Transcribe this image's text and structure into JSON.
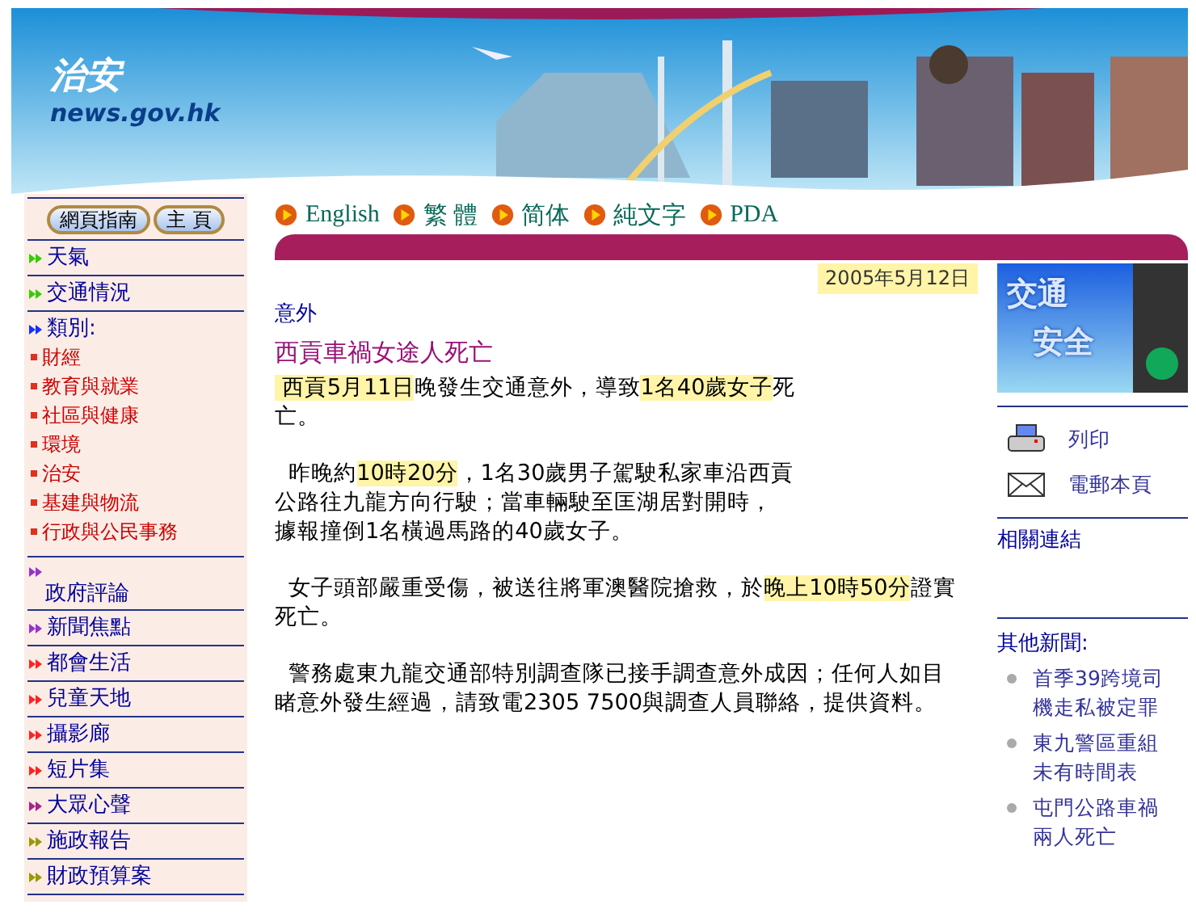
{
  "header": {
    "title": "治安",
    "site": "news.gov.hk"
  },
  "top_buttons": [
    "網頁指南",
    "主 頁"
  ],
  "sidebar": [
    {
      "label": "天氣",
      "color": "#33cc00",
      "kind": "link"
    },
    {
      "label": "交通情況",
      "color": "#33cc00",
      "kind": "link"
    },
    {
      "label": "類別:",
      "color": "#1133ff",
      "kind": "group",
      "children": [
        "財經",
        "教育與就業",
        "社區與健康",
        "環境",
        "治安",
        "基建與物流",
        "行政與公民事務"
      ]
    },
    {
      "label": "政府評論",
      "color": "#9933cc",
      "kind": "stacked"
    },
    {
      "label": "新聞焦點",
      "color": "#9933cc",
      "kind": "link"
    },
    {
      "label": "都會生活",
      "color": "#ff2222",
      "kind": "link"
    },
    {
      "label": "兒童天地",
      "color": "#ff2222",
      "kind": "link"
    },
    {
      "label": "攝影廊",
      "color": "#ff2222",
      "kind": "link"
    },
    {
      "label": "短片集",
      "color": "#ff2222",
      "kind": "link"
    },
    {
      "label": "大眾心聲",
      "color": "#aa2288",
      "kind": "link"
    },
    {
      "label": "施政報告",
      "color": "#999900",
      "kind": "link"
    },
    {
      "label": "財政預算案",
      "color": "#999900",
      "kind": "link"
    }
  ],
  "languages": [
    "English",
    "繁 體",
    "简体",
    "純文字",
    "PDA"
  ],
  "article": {
    "date": "2005年5月12日",
    "category": "意外",
    "headline": "西貢車禍女途人死亡",
    "paragraphs": [
      [
        [
          {
            "text": " 西貢5月11日",
            "highlight": true
          },
          {
            "text": "晚發生交通意外，導致",
            "highlight": false
          },
          {
            "text": "1名40歲女子",
            "highlight": true
          },
          {
            "text": "死",
            "highlight": false
          }
        ],
        [
          {
            "text": "亡。",
            "highlight": false
          }
        ]
      ],
      [
        [
          {
            "text": "  昨晚約",
            "highlight": false
          },
          {
            "text": "10時20分",
            "highlight": true
          },
          {
            "text": "，1名30歲男子駕駛私家車沿西貢",
            "highlight": false
          }
        ],
        [
          {
            "text": "公路往九龍方向行駛；當車輛駛至匡湖居對開時，",
            "highlight": false
          }
        ],
        [
          {
            "text": "據報撞倒1名橫過馬路的40歲女子。",
            "highlight": false
          }
        ]
      ],
      [
        [
          {
            "text": "  女子頭部嚴重受傷，被送往將軍澳醫院搶救，於",
            "highlight": false
          },
          {
            "text": "晚上10時50分",
            "highlight": true
          },
          {
            "text": "證實",
            "highlight": false
          }
        ],
        [
          {
            "text": "死亡。",
            "highlight": false
          }
        ]
      ],
      [
        [
          {
            "text": "  警務處東九龍交通部特別調查隊已接手調查意外成因；任何人如目",
            "highlight": false
          }
        ],
        [
          {
            "text": "睹意外發生經過，請致電2305 7500與調查人員聯絡，提供資料。",
            "highlight": false
          }
        ]
      ]
    ]
  },
  "right": {
    "banner": [
      "交通",
      "安全"
    ],
    "actions": [
      {
        "label": "列印",
        "kind": "print"
      },
      {
        "label": "電郵本頁",
        "kind": "email"
      }
    ],
    "related": "相關連結",
    "other_title": "其他新聞:",
    "other_news": [
      [
        "首季39跨境司",
        "機走私被定罪"
      ],
      [
        "東九警區重組",
        "未有時間表"
      ],
      [
        "屯門公路車禍",
        "兩人死亡"
      ]
    ]
  }
}
